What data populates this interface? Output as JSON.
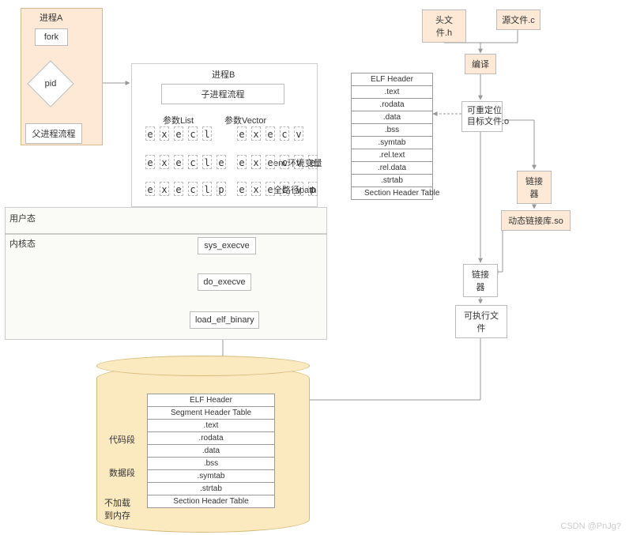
{
  "sections": {
    "userspace": "用户态",
    "kernelspace": "内核态"
  },
  "procA": {
    "title": "进程A",
    "fork": "fork",
    "pid": "pid",
    "parentFlow": "父进程流程"
  },
  "procB": {
    "title": "进程B",
    "childFlow": "子进程流程",
    "colList": "参数List",
    "colVector": "参数Vector",
    "envNote": "env环境变量",
    "pathNote": "全路径path",
    "rows": [
      [
        "e",
        "x",
        "e",
        "c",
        "l",
        "",
        "e",
        "x",
        "e",
        "c",
        "v",
        ""
      ],
      [
        "e",
        "x",
        "e",
        "c",
        "l",
        "e",
        "e",
        "x",
        "e",
        "c",
        "v",
        "e"
      ],
      [
        "e",
        "x",
        "e",
        "c",
        "l",
        "p",
        "e",
        "x",
        "e",
        "c",
        "v",
        "p"
      ]
    ]
  },
  "kernel": {
    "sys": "sys_execve",
    "do": "do_execve",
    "load": "load_elf_binary"
  },
  "toolchain": {
    "header": "头文件.h",
    "source": "源文件.c",
    "compile": "编译",
    "relocatable": "可重定位\n目标文件.o",
    "linker": "链接器",
    "dynlib": "动态链接库.so",
    "linker2": "链接器",
    "exe": "可执行文件"
  },
  "elf_obj": {
    "rows": [
      "ELF Header",
      ".text",
      ".rodata",
      ".data",
      ".bss",
      ".symtab",
      ".rel.text",
      ".rel.data",
      ".strtab",
      "Section Header Table"
    ]
  },
  "elf_exe": {
    "rows": [
      "ELF Header",
      "Segment Header Table",
      ".text",
      ".rodata",
      ".data",
      ".bss",
      ".symtab",
      ".strtab",
      "Section Header Table"
    ],
    "group_code": "代码段",
    "group_data": "数据段",
    "group_noload": "不加载\n到内存"
  },
  "watermark": "CSDN @PnJg?"
}
